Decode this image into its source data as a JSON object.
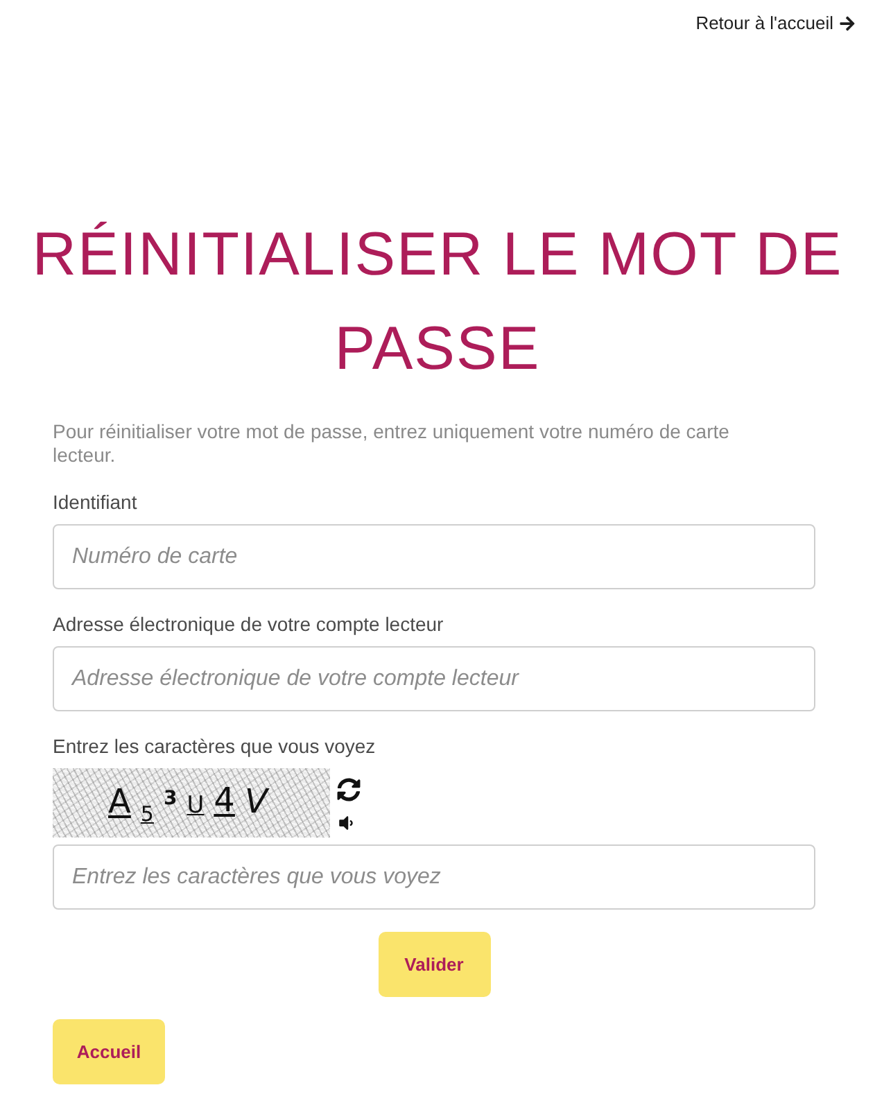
{
  "header": {
    "back_link": "Retour à l'accueil"
  },
  "title": "RÉINITIALISER LE MOT DE PASSE",
  "intro": "Pour réinitialiser votre mot de passe, entrez uniquement votre numéro de carte lecteur.",
  "fields": [
    {
      "label": "Identifiant",
      "placeholder": "Numéro de carte"
    },
    {
      "label": "Adresse électronique de votre compte lecteur",
      "placeholder": "Adresse électronique de votre compte lecteur"
    }
  ],
  "captcha": {
    "label": "Entrez les caractères que vous voyez",
    "characters": [
      "A",
      "5",
      "3",
      "U",
      "4",
      "V"
    ],
    "placeholder": "Entrez les caractères que vous voyez"
  },
  "submit_button": "Valider",
  "home_button": "Accueil"
}
